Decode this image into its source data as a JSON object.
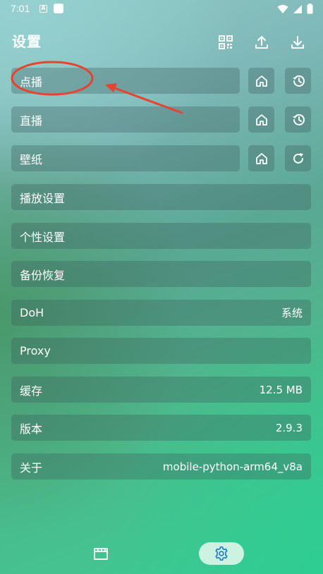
{
  "status_bar": {
    "time": "7:01",
    "notif_letter": "A"
  },
  "header": {
    "title": "设置",
    "icons": [
      "qr-code-icon",
      "upload-icon",
      "download-icon"
    ]
  },
  "rows": {
    "vod": {
      "label": "点播",
      "buttons": [
        "home-icon",
        "history-icon"
      ]
    },
    "live": {
      "label": "直播",
      "buttons": [
        "home-icon",
        "history-icon"
      ]
    },
    "wallpaper": {
      "label": "壁纸",
      "buttons": [
        "home-icon",
        "refresh-icon"
      ]
    },
    "playback": {
      "label": "播放设置"
    },
    "personal": {
      "label": "个性设置"
    },
    "backup": {
      "label": "备份恢复"
    },
    "doh": {
      "label": "DoH",
      "value": "系统"
    },
    "proxy": {
      "label": "Proxy",
      "value": ""
    },
    "cache": {
      "label": "缓存",
      "value": "12.5 MB"
    },
    "version": {
      "label": "版本",
      "value": "2.9.3"
    },
    "about": {
      "label": "关于",
      "value": "mobile-python-arm64_v8a"
    }
  },
  "bottom_nav": {
    "items": [
      "movie-clapper-icon",
      "settings-gear-icon"
    ],
    "active": "settings-gear-icon"
  },
  "annotation": {
    "color": "#e8432f"
  }
}
